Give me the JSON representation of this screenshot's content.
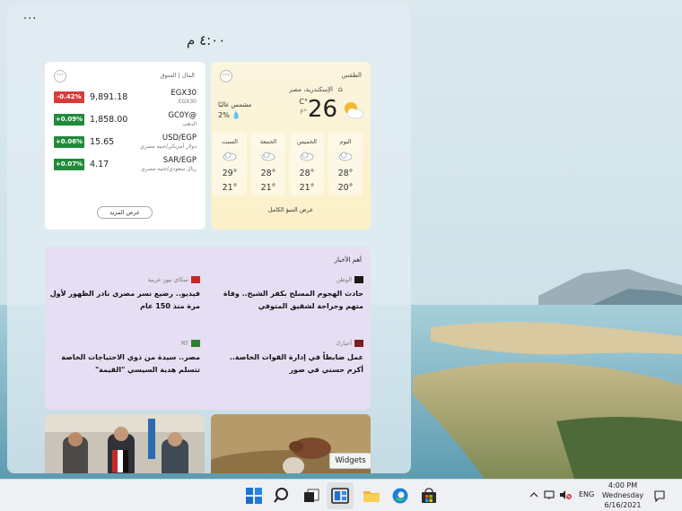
{
  "panel": {
    "menu_icon": "ellipsis-icon",
    "time": "٤:٠٠ م"
  },
  "money": {
    "header": "المال | السوق",
    "more": "···",
    "stocks": [
      {
        "change": "-0.42%",
        "direction": "down",
        "price": "9,891.18",
        "symbol": "EGX30",
        "name": "EGX30"
      },
      {
        "change": "+0.09%",
        "direction": "up",
        "price": "1,858.00",
        "symbol": "GC0Y@",
        "name": "الذهب"
      },
      {
        "change": "+0.06%",
        "direction": "up",
        "price": "15.65",
        "symbol": "USD/EGP",
        "name": "دولار أمريكي/جنيه مصري"
      },
      {
        "change": "+0.07%",
        "direction": "up",
        "price": "4.17",
        "symbol": "SAR/EGP",
        "name": "ريال سعودي/جنيه مصري"
      }
    ],
    "see_more": "عرض المزيد"
  },
  "weather": {
    "header": "الطقس",
    "more": "···",
    "location": "الإسكندرية، مصر",
    "temp": "26",
    "unit_c": "C°",
    "unit_f": "F°",
    "condition": "مشمس غالبًا",
    "precip": "2% 💧",
    "days": [
      {
        "name": "اليوم",
        "high": "28°",
        "low": "20°"
      },
      {
        "name": "الخميس",
        "high": "28°",
        "low": "21°"
      },
      {
        "name": "الجمعة",
        "high": "28°",
        "low": "21°"
      },
      {
        "name": "السبت",
        "high": "29°",
        "low": "21°"
      }
    ],
    "see_forecast": "عرض التنبؤ الكامل"
  },
  "news": {
    "header": "أهم الأخبار",
    "items": [
      {
        "source": "الوطن",
        "title": "حادث الهجوم المسلح بكفر الشيخ.. وفاة متهم وجراحة لشقيق المتوفي",
        "logo_color": "#1a1a1a"
      },
      {
        "source": "سكاي نيوز عربية",
        "title": "فيديو.. رضيع نسر مصري نادر الظهور لأول مرة منذ 150 عام",
        "logo_color": "#c62828"
      },
      {
        "source": "أخبارك",
        "title": "عمل ضابطاً في إدارة القوات الخاصة.. أكرم حسني في صور",
        "logo_color": "#7a1f1f"
      },
      {
        "source": "RT",
        "title": "مصر.. سيدة من ذوي الاحتياجات الخاصة تتسلم هدية السيسي \"القيمة\"",
        "logo_color": "#2e7d32"
      }
    ]
  },
  "tooltip": "Widgets",
  "taskbar": {
    "apps": [
      "start-icon",
      "search-icon",
      "task-view-icon",
      "widgets-icon",
      "file-explorer-icon",
      "edge-icon",
      "store-icon"
    ],
    "lang": "ENG",
    "time": "4:00 PM",
    "day": "Wednesday",
    "date": "6/16/2021"
  }
}
